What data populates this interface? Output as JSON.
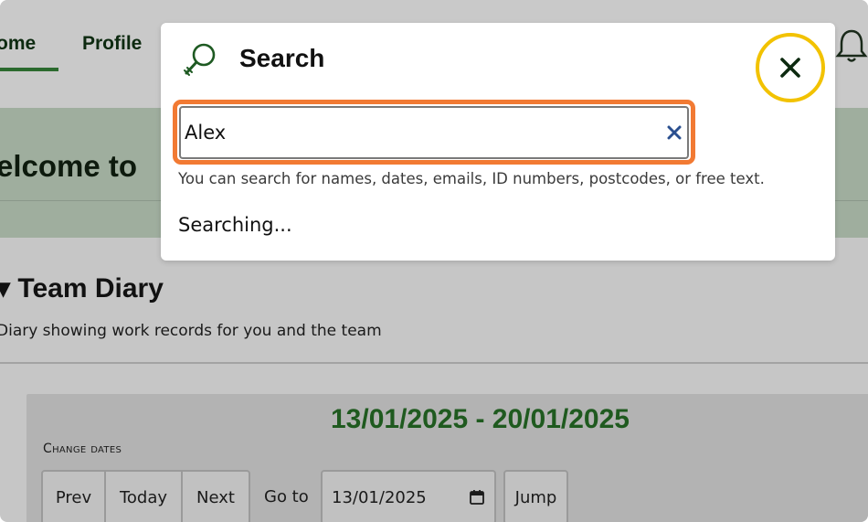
{
  "nav": {
    "home_label": "ome",
    "profile_label": "Profile"
  },
  "page": {
    "welcome_title": "elcome to",
    "diary_title": "▾ Team Diary",
    "diary_subtitle": "Diary showing work records for you and the team",
    "date_range": "13/01/2025 - 20/01/2025",
    "change_dates_label": "Change dates",
    "buttons": {
      "prev": "Prev",
      "today": "Today",
      "next": "Next",
      "jump": "Jump"
    },
    "goto_label": "Go to",
    "goto_date_value": "13/01/2025"
  },
  "search_modal": {
    "title": "Search",
    "input_value": "Alex",
    "hint": "You can search for names, dates, emails, ID numbers, postcodes, or free text.",
    "status": "Searching..."
  },
  "icons": {
    "search": "magnifier-icon",
    "close": "close-icon",
    "clear": "clear-x-icon",
    "bell": "bell-icon",
    "calendar": "calendar-icon"
  },
  "colors": {
    "brand_green": "#2b6a2e",
    "date_green": "#1f5a1f",
    "focus_orange": "#f27a33",
    "close_highlight": "#f2c200",
    "clear_blue": "#2a4f8f"
  }
}
